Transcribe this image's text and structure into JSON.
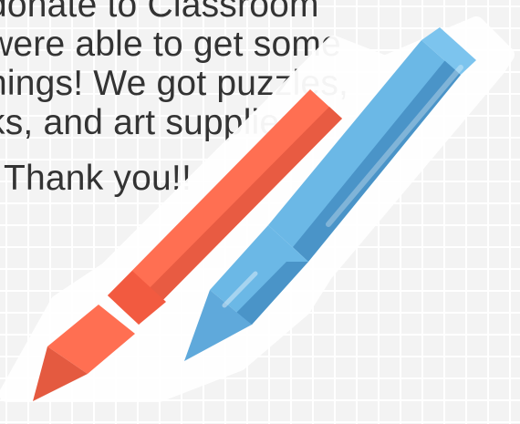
{
  "message": {
    "line1": "donate to Classroom",
    "line2": "were able to get some",
    "line3": "hings!  We got puzzles,",
    "line4": "ks, and art supplies!",
    "thanks": "Thank you!!"
  },
  "colors": {
    "background": "#f3f3f3",
    "grid": "#ffffff",
    "text": "#333333",
    "crayon_red": "#ff6f52",
    "crayon_red_dark": "#e85b42",
    "crayon_blue": "#6bb8e6",
    "crayon_blue_dark": "#4a94c8",
    "crayon_outline": "#ffffff"
  },
  "illustration": {
    "subject": "crayon-pair-sticker",
    "items": [
      "red-crayon",
      "blue-crayon"
    ]
  }
}
